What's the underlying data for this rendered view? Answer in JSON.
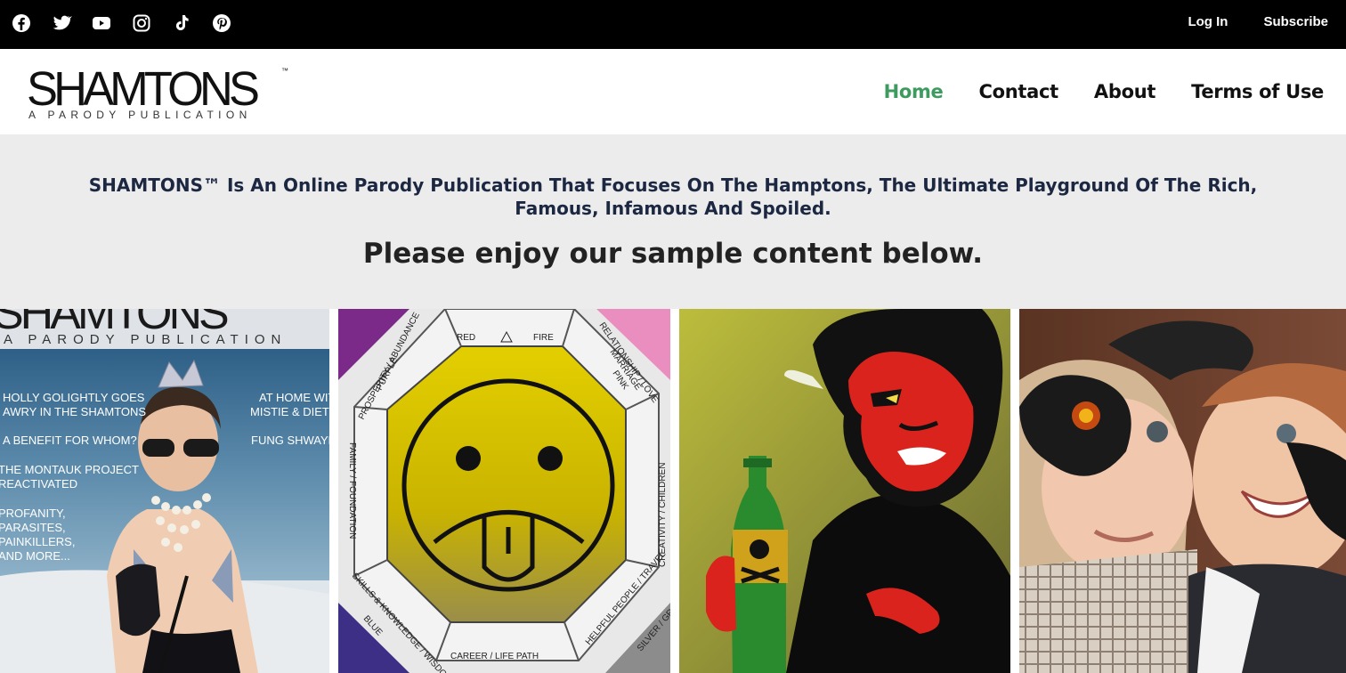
{
  "topbar": {
    "social_icons": [
      "facebook-icon",
      "twitter-icon",
      "youtube-icon",
      "instagram-icon",
      "tiktok-icon",
      "pinterest-icon"
    ],
    "login_label": "Log In",
    "subscribe_label": "Subscribe"
  },
  "header": {
    "logo_text": "SHAMTONS",
    "logo_tm": "™",
    "logo_tagline": "A PARODY PUBLICATION",
    "nav": [
      {
        "label": "Home",
        "active": true
      },
      {
        "label": "Contact",
        "active": false
      },
      {
        "label": "About",
        "active": false
      },
      {
        "label": "Terms of Use",
        "active": false
      }
    ]
  },
  "intro": {
    "lead": "SHAMTONS™ Is An Online Parody Publication That Focuses On The Hamptons, The Ultimate Playground Of The Rich, Famous, Infamous And Spoiled.",
    "enjoy": "Please enjoy our sample content below."
  },
  "gallery": {
    "cover": {
      "masthead": "SHAMTONS",
      "tagline": "A PARODY PUBLICATION",
      "left_lines": [
        "HOLLY GOLIGHTLY GOES",
        "AWRY IN THE SHAMTONS",
        "A BENEFIT FOR WHOM?",
        "THE MONTAUK PROJECT",
        "REACTIVATED",
        "PROFANITY,",
        "PARASITES,",
        "PAINKILLERS,",
        "AND MORE..."
      ],
      "right_lines": [
        "AT HOME WITH",
        "MISTIE & DIETER",
        "FUNG SHWAYED"
      ]
    },
    "bagua": {
      "top": "RED",
      "top_right": "FIRE",
      "purple": "PURPLE",
      "prosperity": "PROSPERITY / ABUNDANCE",
      "relationship": "RELATIONSHIP / LOVE",
      "marriage": "MARRIAGE",
      "pink": "PINK",
      "family": "FAMILY / FOUNDATION",
      "creativity": "CREATIVITY / CHILDREN",
      "skills": "SKILLS & KNOWLEDGE / WISDOM",
      "blue": "BLUE",
      "career": "CAREER / LIFE PATH",
      "helpful": "HELPFUL PEOPLE / TRAVEL",
      "silver": "SILVER / GRAY"
    }
  },
  "colors": {
    "topbar": "#000000",
    "nav_active": "#3e9b5f",
    "intro_bg": "#ececec",
    "lead_text": "#1c2742"
  }
}
